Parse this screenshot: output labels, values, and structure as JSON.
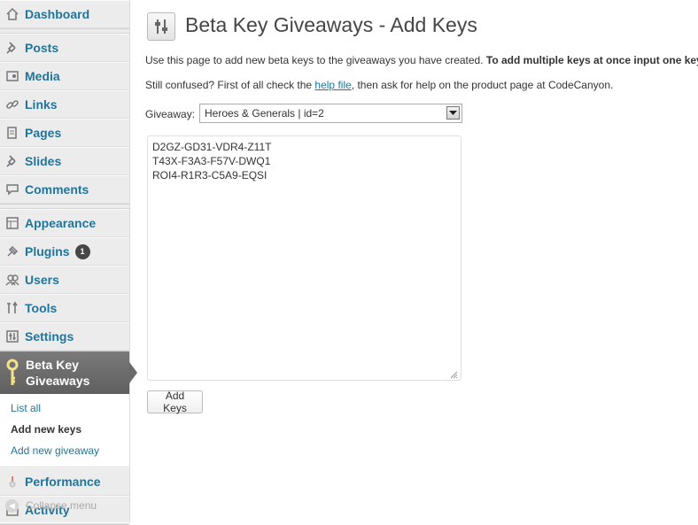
{
  "sidebar": {
    "dashboard": "Dashboard",
    "posts": "Posts",
    "media": "Media",
    "links": "Links",
    "pages": "Pages",
    "slides": "Slides",
    "comments": "Comments",
    "appearance": "Appearance",
    "plugins": "Plugins",
    "plugins_badge": "1",
    "users": "Users",
    "tools": "Tools",
    "settings": "Settings",
    "current_line1": "Beta Key",
    "current_line2": "Giveaways",
    "submenu": {
      "list_all": "List all",
      "add_new_keys": "Add new keys",
      "add_new_giveaway": "Add new giveaway"
    },
    "performance": "Performance",
    "activity": "Activity",
    "collapse": "Collapse menu"
  },
  "main": {
    "title": "Beta Key Giveaways - Add Keys",
    "intro_plain": "Use this page to add new beta keys to the giveaways you have created. ",
    "intro_bold": "To add multiple keys at once input one key",
    "help_pre": "Still confused? First of all check the ",
    "help_link": "help file",
    "help_post": ", then ask for help on the product page at CodeCanyon.",
    "giveaway_label": "Giveaway:",
    "giveaway_selected": "Heroes & Generals | id=2",
    "keys": [
      "D2GZ-GD31-VDR4-Z11T",
      "T43X-F3A3-F57V-DWQ1",
      "ROI4-R1R3-C5A9-EQSI"
    ],
    "add_keys_button": "Add Keys"
  },
  "colors": {
    "link": "#21759b",
    "sidebar_bg": "#ececec",
    "current_bg": "#6a6a6a"
  }
}
